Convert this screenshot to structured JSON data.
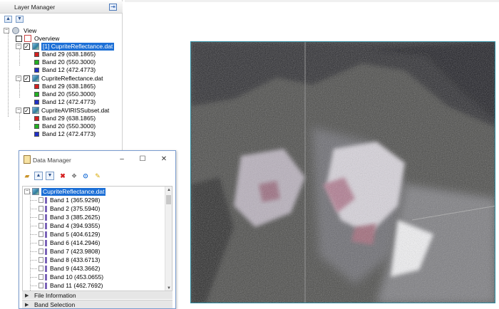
{
  "layer_manager": {
    "title": "Layer Manager",
    "view_label": "View",
    "overview_label": "Overview",
    "layers": [
      {
        "name": "[1] CupriteReflectance.dat",
        "selected": true,
        "bands": [
          {
            "label": "Band 29 (638.1865)",
            "color": "#d42020"
          },
          {
            "label": "Band 20 (550.3000)",
            "color": "#22b022"
          },
          {
            "label": "Band 12 (472.4773)",
            "color": "#2030c8"
          }
        ]
      },
      {
        "name": "CupriteReflectance.dat",
        "selected": false,
        "bands": [
          {
            "label": "Band 29 (638.1865)",
            "color": "#d42020"
          },
          {
            "label": "Band 20 (550.3000)",
            "color": "#22b022"
          },
          {
            "label": "Band 12 (472.4773)",
            "color": "#2030c8"
          }
        ]
      },
      {
        "name": "CupriteAVIRISSubset.dat",
        "selected": false,
        "bands": [
          {
            "label": "Band 29 (638.1865)",
            "color": "#d42020"
          },
          {
            "label": "Band 20 (550.3000)",
            "color": "#22b022"
          },
          {
            "label": "Band 12 (472.4773)",
            "color": "#2030c8"
          }
        ]
      }
    ]
  },
  "data_manager": {
    "title": "Data Manager",
    "toolbar_icons": [
      "open-folder-icon",
      "expand-icon",
      "collapse-icon",
      "close-file-icon",
      "band-animation-icon",
      "link-icon",
      "pin-icon"
    ],
    "file_name": "CupriteReflectance.dat",
    "bands": [
      "Band 1 (365.9298)",
      "Band 2 (375.5940)",
      "Band 3 (385.2625)",
      "Band 4 (394.9355)",
      "Band 5 (404.6129)",
      "Band 6 (414.2946)",
      "Band 7 (423.9808)",
      "Band 8 (433.6713)",
      "Band 9 (443.3662)",
      "Band 10 (453.0655)",
      "Band 11 (462.7692)"
    ],
    "sections": [
      "File Information",
      "Band Selection"
    ]
  },
  "colors": {
    "selection": "#1c6fd6",
    "image_border": "#2a8aa0"
  }
}
